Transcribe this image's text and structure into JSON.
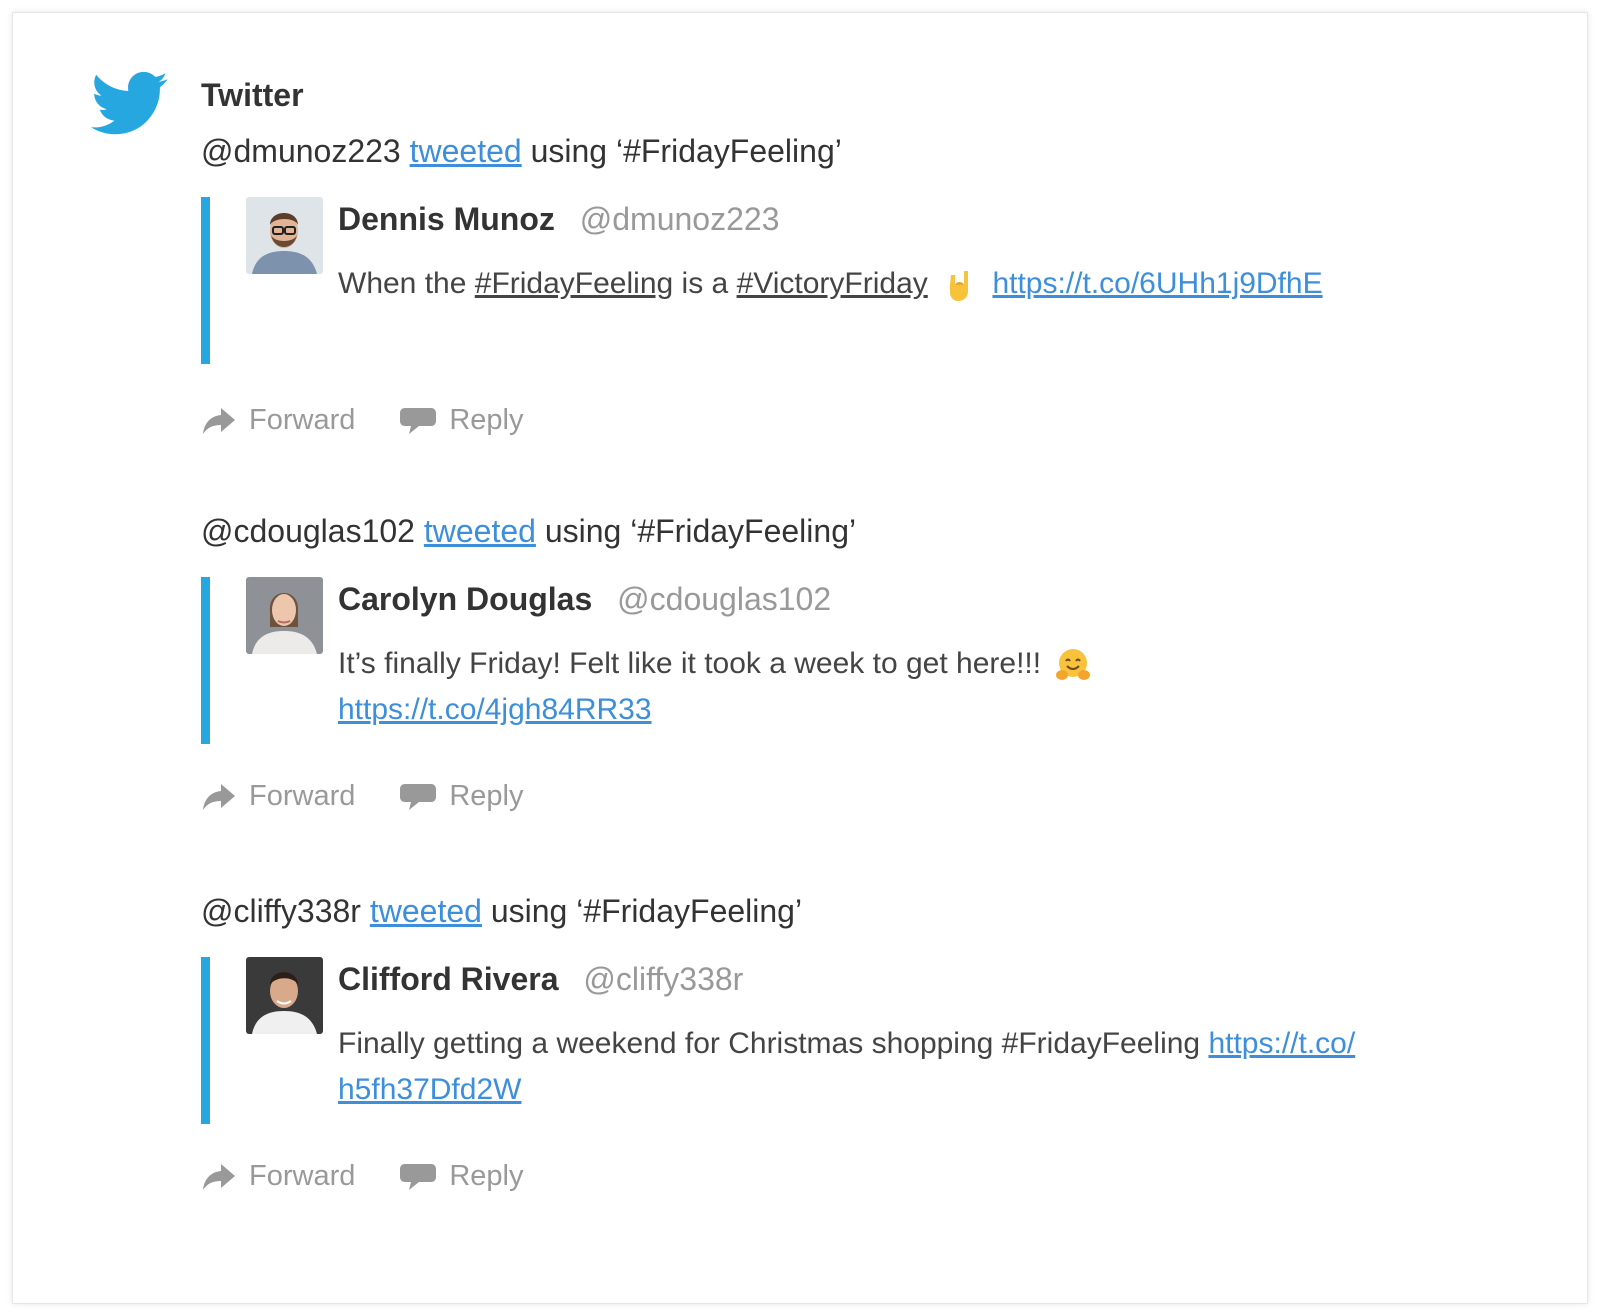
{
  "app": {
    "title": "Twitter",
    "icon": "twitter-bird-icon",
    "accent": "#27a7e0",
    "link_color": "#3d8edb"
  },
  "entries": [
    {
      "user": "@dmunoz223",
      "verb": "tweeted",
      "suffix": "using ‘#FridayFeeling’",
      "name": "Dennis Munoz",
      "handle": "@dmunoz223",
      "text_1": "When the",
      "tag_1": "#FridayFeeling",
      "text_2": "is a",
      "tag_2": "#VictoryFriday",
      "emoji": "sign-of-the-horns-emoji",
      "url": "https://t.co/6UHh1j9DfhE",
      "forward": "Forward",
      "reply": "Reply"
    },
    {
      "user": "@cdouglas102",
      "verb": "tweeted",
      "suffix": "using ‘#FridayFeeling’",
      "name": "Carolyn Douglas",
      "handle": "@cdouglas102",
      "text": "It’s finally Friday! Felt like it took a week to get here!!!",
      "emoji": "hugging-face-emoji",
      "url": "https://t.co/4jgh84RR33",
      "forward": "Forward",
      "reply": "Reply"
    },
    {
      "user": "@cliffy338r",
      "verb": "tweeted",
      "suffix": "using ‘#FridayFeeling’",
      "name": "Clifford Rivera",
      "handle": "@cliffy338r",
      "text": "Finally getting a weekend for Christmas shopping #FridayFeeling",
      "url_1": "https://t.co/",
      "url_2": "h5fh37Dfd2W",
      "forward": "Forward",
      "reply": "Reply"
    }
  ]
}
